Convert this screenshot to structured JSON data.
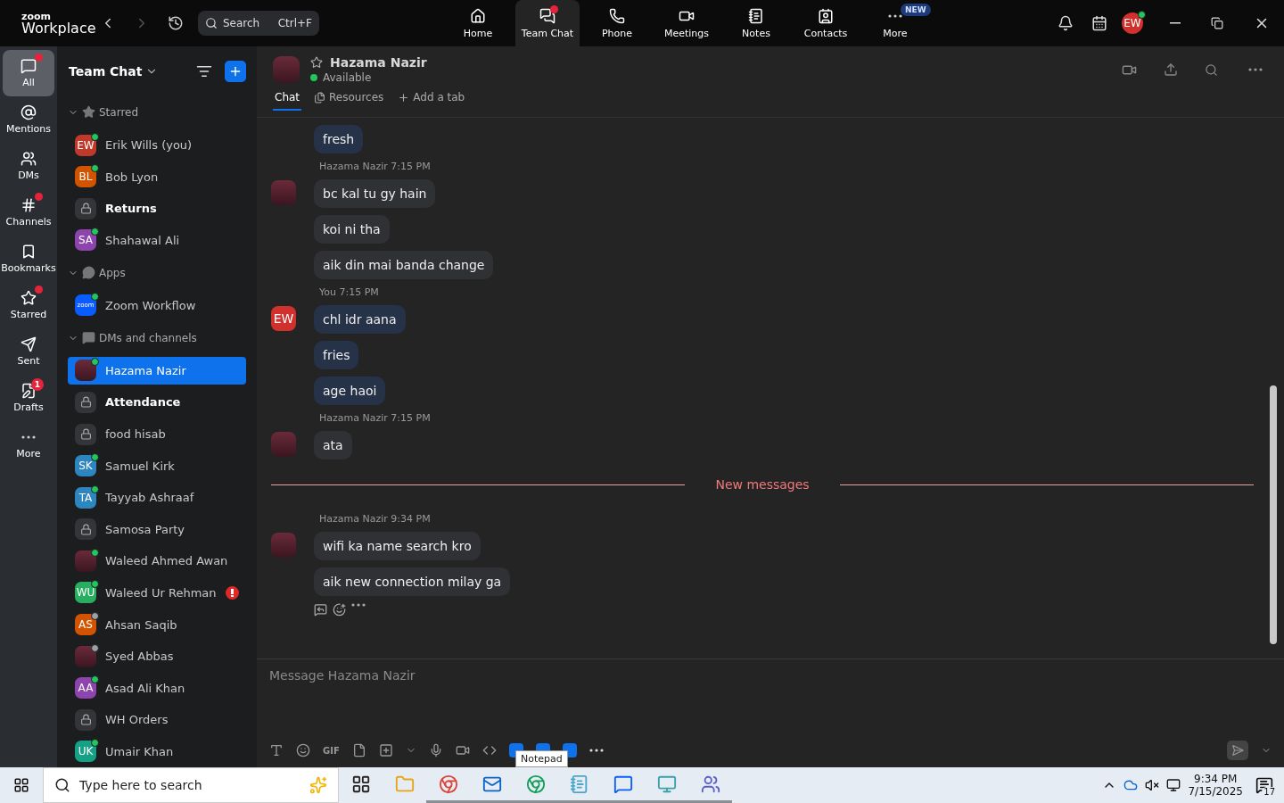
{
  "brand": {
    "small": "zoom",
    "name": "Workplace"
  },
  "search": {
    "placeholder": "Search",
    "shortcut": "Ctrl+F"
  },
  "nav": [
    {
      "label": "Home",
      "selected": false,
      "dot": false
    },
    {
      "label": "Team Chat",
      "selected": true,
      "dot": true
    },
    {
      "label": "Phone",
      "selected": false,
      "dot": false
    },
    {
      "label": "Meetings",
      "selected": false,
      "dot": false
    },
    {
      "label": "Notes",
      "selected": false,
      "dot": false
    },
    {
      "label": "Contacts",
      "selected": false,
      "dot": false
    },
    {
      "label": "More",
      "selected": false,
      "dot": false,
      "badge": "NEW"
    }
  ],
  "user": {
    "initials": "EW",
    "online": true
  },
  "rail": [
    {
      "label": "All",
      "selected": true,
      "dot": true
    },
    {
      "label": "Mentions",
      "selected": false,
      "dot": false
    },
    {
      "label": "DMs",
      "selected": false,
      "dot": false
    },
    {
      "label": "Channels",
      "selected": false,
      "dot": true
    },
    {
      "label": "Bookmarks",
      "selected": false,
      "dot": false
    },
    {
      "label": "Starred",
      "selected": false,
      "dot": true
    },
    {
      "label": "Sent",
      "selected": false,
      "dot": false
    },
    {
      "label": "Drafts",
      "selected": false,
      "dot": false,
      "badge": "1"
    },
    {
      "label": "More",
      "selected": false,
      "dot": false
    }
  ],
  "sidebar": {
    "title": "Team Chat",
    "sections": [
      {
        "title": "Starred",
        "expanded": true,
        "items": [
          {
            "kind": "person",
            "name": "Erik Wills (you)",
            "initials": "EW",
            "color": "#c0392b",
            "online": true,
            "bold": false,
            "selected": false,
            "alert": false
          },
          {
            "kind": "person",
            "name": "Bob Lyon",
            "initials": "BL",
            "color": "#d35400",
            "online": true,
            "bold": false,
            "selected": false,
            "alert": false
          },
          {
            "kind": "channel",
            "name": "Returns",
            "bold": true,
            "selected": false,
            "alert": false
          },
          {
            "kind": "person",
            "name": "Shahawal Ali",
            "initials": "SA",
            "color": "#8e44ad",
            "online": true,
            "bold": false,
            "selected": false,
            "alert": false
          }
        ]
      },
      {
        "title": "Apps",
        "expanded": true,
        "items": [
          {
            "kind": "app",
            "name": "Zoom Workflow",
            "initials": "zoom",
            "color": "#0b5cff",
            "online": true,
            "bold": false,
            "selected": false,
            "alert": false
          }
        ]
      },
      {
        "title": "DMs and channels",
        "expanded": true,
        "items": [
          {
            "kind": "photo",
            "name": "Hazama Nazir",
            "online": true,
            "bold": false,
            "selected": true,
            "alert": false
          },
          {
            "kind": "channel",
            "name": "Attendance",
            "bold": true,
            "selected": false,
            "alert": false
          },
          {
            "kind": "channel",
            "name": "food hisab",
            "bold": false,
            "selected": false,
            "alert": false
          },
          {
            "kind": "person",
            "name": "Samuel Kirk",
            "initials": "SK",
            "color": "#2e86c1",
            "online": true,
            "bold": false,
            "selected": false,
            "alert": false
          },
          {
            "kind": "person",
            "name": "Tayyab Ashraaf",
            "initials": "TA",
            "color": "#2e86c1",
            "online": true,
            "bold": false,
            "selected": false,
            "alert": false
          },
          {
            "kind": "channel",
            "name": "Samosa Party",
            "bold": false,
            "selected": false,
            "alert": false
          },
          {
            "kind": "photo",
            "name": "Waleed Ahmed Awan",
            "online": true,
            "bold": false,
            "selected": false,
            "alert": false
          },
          {
            "kind": "person",
            "name": "Waleed Ur Rehman",
            "initials": "WU",
            "color": "#27ae60",
            "online": true,
            "bold": false,
            "selected": false,
            "alert": true
          },
          {
            "kind": "person",
            "name": "Ahsan Saqib",
            "initials": "AS",
            "color": "#d35400",
            "online": false,
            "bold": false,
            "selected": false,
            "alert": false
          },
          {
            "kind": "photo",
            "name": "Syed Abbas",
            "online": false,
            "bold": false,
            "selected": false,
            "alert": false
          },
          {
            "kind": "person",
            "name": "Asad Ali Khan",
            "initials": "AA",
            "color": "#8e44ad",
            "online": true,
            "bold": false,
            "selected": false,
            "alert": false
          },
          {
            "kind": "channel",
            "name": "WH Orders",
            "bold": false,
            "selected": false,
            "alert": false
          },
          {
            "kind": "person",
            "name": "Umair Khan",
            "initials": "UK",
            "color": "#16a085",
            "online": true,
            "bold": false,
            "selected": false,
            "alert": false
          }
        ]
      }
    ]
  },
  "chat": {
    "name": "Hazama Nazir",
    "status": "Available",
    "starred": false,
    "tabs": [
      {
        "label": "Chat",
        "selected": true
      },
      {
        "label": "Resources",
        "selected": false
      }
    ],
    "add_tab": "Add a tab"
  },
  "timeline": [
    {
      "kind": "group",
      "mine": true,
      "messages": [
        "fresh"
      ]
    },
    {
      "kind": "group",
      "mine": false,
      "sender": "Hazama Nazir",
      "time": "7:15 PM",
      "messages": [
        "bc kal tu gy hain",
        "koi ni tha",
        "aik din mai banda change"
      ]
    },
    {
      "kind": "group",
      "mine": true,
      "sender": "You",
      "time": "7:15 PM",
      "initials": "EW",
      "messages": [
        "chl idr aana",
        "fries",
        "age haoi"
      ]
    },
    {
      "kind": "group",
      "mine": false,
      "sender": "Hazama Nazir",
      "time": "7:15 PM",
      "messages": [
        "ata"
      ]
    },
    {
      "kind": "divider",
      "label": "New messages"
    },
    {
      "kind": "group",
      "mine": false,
      "sender": "Hazama Nazir",
      "time": "9:34 PM",
      "messages": [
        "wifi ka name search kro",
        "aik new connection milay ga"
      ],
      "actions": true
    }
  ],
  "composer": {
    "placeholder": "Message Hazama Nazir",
    "gif": "GIF",
    "tooltip": "Notepad"
  },
  "taskbar": {
    "search_placeholder": "Type here to search",
    "apps": [
      {
        "running": false
      },
      {
        "running": false
      },
      {
        "running": true
      },
      {
        "running": true
      },
      {
        "running": true
      },
      {
        "running": true
      },
      {
        "running": true
      },
      {
        "running": true
      },
      {
        "running": true
      }
    ],
    "time": "9:34 PM",
    "date": "7/15/2025",
    "notifications": "17"
  }
}
